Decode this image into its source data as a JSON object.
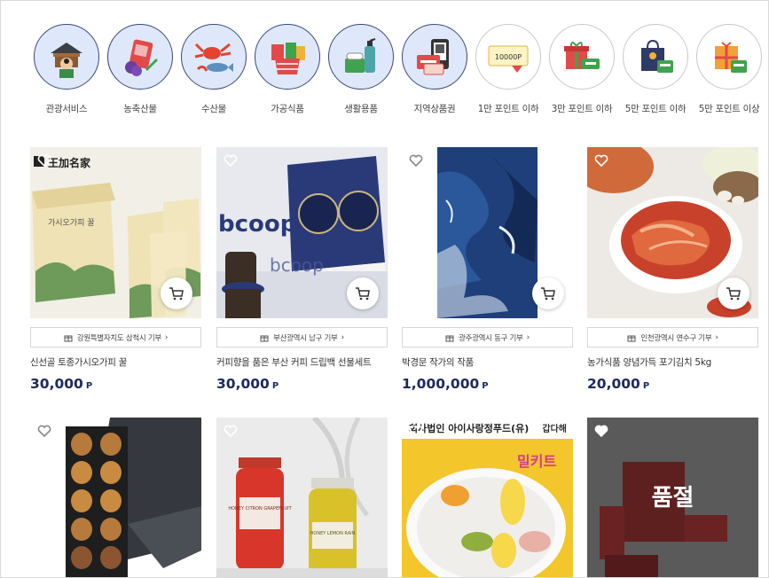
{
  "categories": [
    {
      "label": "관광서비스",
      "icon": "tour-service-icon",
      "style": "blue"
    },
    {
      "label": "농축산물",
      "icon": "meat-produce-icon",
      "style": "blue"
    },
    {
      "label": "수산물",
      "icon": "seafood-icon",
      "style": "blue"
    },
    {
      "label": "가공식품",
      "icon": "processed-food-icon",
      "style": "blue"
    },
    {
      "label": "생활용품",
      "icon": "household-goods-icon",
      "style": "blue"
    },
    {
      "label": "지역상품권",
      "icon": "local-voucher-icon",
      "style": "blue"
    },
    {
      "label": "1만 포인트 이하",
      "icon": "10000-point-voucher-icon",
      "style": "white",
      "badge": "10000P"
    },
    {
      "label": "3만 포인트 이하",
      "icon": "gift-box-icon",
      "style": "white"
    },
    {
      "label": "5만 포인트 이하",
      "icon": "gift-bag-icon",
      "style": "white"
    },
    {
      "label": "5만 포인트 이상",
      "icon": "premium-gift-icon",
      "style": "white"
    }
  ],
  "products": [
    {
      "donation": "강원특별자치도 삼척시 기부",
      "name": "신선골 토종가시오가피 꿀",
      "price": "30,000",
      "unit": "P",
      "brand": "王加名家",
      "box_text": "가시오가피 꿀"
    },
    {
      "donation": "부산광역시 남구 기부",
      "name": "커피향을 품은 부산 커피 드립백 선물세트",
      "price": "30,000",
      "unit": "P",
      "brand": "bcoop"
    },
    {
      "donation": "광주광역시 동구 기부",
      "name": "박경문 작가의 작품",
      "price": "1,000,000",
      "unit": "P"
    },
    {
      "donation": "인천광역시 연수구 기부",
      "name": "농가식품 양념가득 포기김치 5kg",
      "price": "20,000",
      "unit": "P"
    },
    {
      "name": "owl-sweets",
      "hidden_name": true
    },
    {
      "jar1": "HONEY CITRON GRAPEFRUIT",
      "jar2": "HONEY LEMON RAIN"
    },
    {
      "banner": "회사법인 아이사랑정푸드(유)",
      "brand": "갑다해",
      "kit_text": "밀키트"
    },
    {
      "soldout": "품절"
    }
  ],
  "colors": {
    "accent": "#1c2a5e",
    "circle_blue": "#dfe8fb"
  }
}
